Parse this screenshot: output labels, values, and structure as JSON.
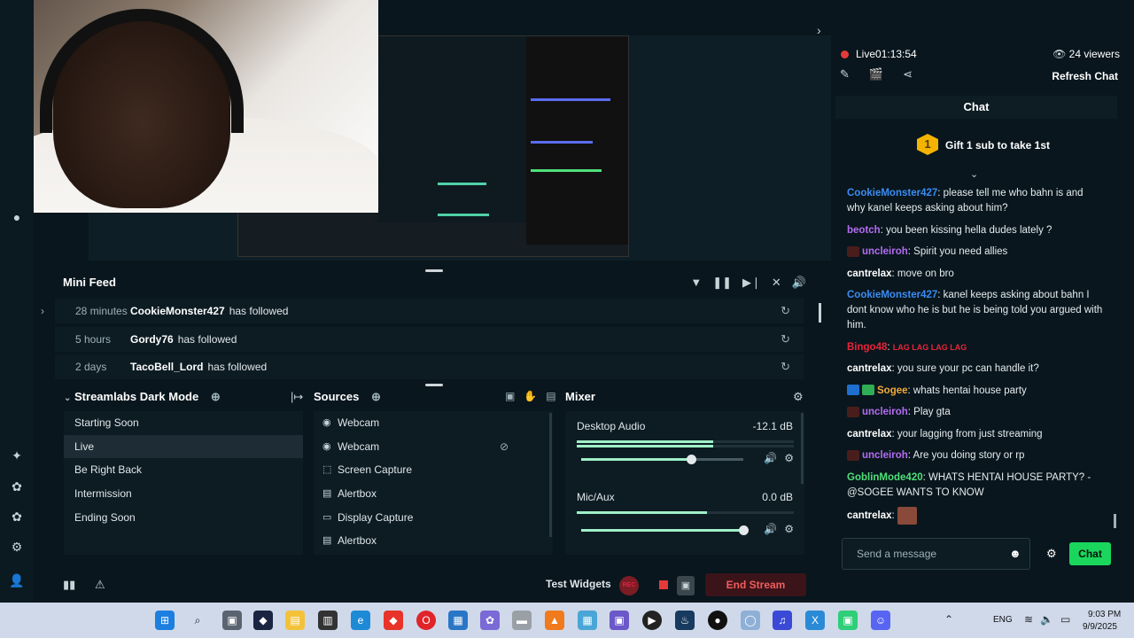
{
  "window": {
    "minimize": "—",
    "maximize": "☐",
    "close": "✕"
  },
  "mini_feed": {
    "title": "Mini Feed",
    "events": [
      {
        "time": "28 minutes",
        "user": "CookieMonster427",
        "action": "has followed"
      },
      {
        "time": "5 hours",
        "user": "Gordy76",
        "action": "has followed"
      },
      {
        "time": "2 days",
        "user": "TacoBell_Lord",
        "action": "has followed"
      }
    ]
  },
  "scenes": {
    "title": "Streamlabs Dark Mode",
    "items": [
      "Starting Soon",
      "Live",
      "Be Right Back",
      "Intermission",
      "Ending Soon"
    ],
    "active": "Live"
  },
  "sources": {
    "title": "Sources",
    "items": [
      {
        "name": "Webcam",
        "icon": "webcam-icon"
      },
      {
        "name": "Webcam",
        "icon": "webcam-icon"
      },
      {
        "name": "Screen Capture",
        "icon": "screen-capture-icon"
      },
      {
        "name": "Alertbox",
        "icon": "alertbox-icon"
      },
      {
        "name": "Display Capture",
        "icon": "display-icon"
      },
      {
        "name": "Alertbox",
        "icon": "alertbox-icon"
      }
    ]
  },
  "mixer": {
    "title": "Mixer",
    "channels": [
      {
        "name": "Desktop Audio",
        "db": "-12.1 dB",
        "meter": 0.63,
        "volume": 0.68
      },
      {
        "name": "Mic/Aux",
        "db": "0.0 dB",
        "meter": 0.6,
        "volume": 1.0
      }
    ]
  },
  "footer": {
    "test_widgets": "Test Widgets",
    "rec": "REC",
    "end_stream": "End Stream"
  },
  "stream": {
    "live_label": "Live",
    "live_time": "01:13:54",
    "viewers": "24 viewers",
    "refresh_chat": "Refresh Chat"
  },
  "chat": {
    "title": "Chat",
    "gift_badge": "1",
    "gift_text": "Gift 1 sub to take 1st",
    "messages": [
      {
        "user": "CookieMonster427",
        "color": "#3b8cf2",
        "text": "please tell me who bahn is and why kanel keeps asking about him?"
      },
      {
        "user": "beotch",
        "color": "#b46cf2",
        "text": "you been kissing hella dudes lately ?"
      },
      {
        "user": "uncleiroh",
        "color": "#b46cf2",
        "text": "Spirit you need allies"
      },
      {
        "user": "cantrelax",
        "color": "#ffffff",
        "text": "move on bro"
      },
      {
        "user": "CookieMonster427",
        "color": "#3b8cf2",
        "text": "kanel keeps asking about bahn I dont know who he is but he is being told you argued with him."
      },
      {
        "user": "Bingo48",
        "color": "#e8253a",
        "text": "LAG LAG LAG LAG"
      },
      {
        "user": "cantrelax",
        "color": "#ffffff",
        "text": "you sure your pc can handle it?"
      },
      {
        "user": "Sogee",
        "color": "#f2a93b",
        "text": "whats hentai house party"
      },
      {
        "user": "uncleiroh",
        "color": "#b46cf2",
        "text": "Play gta"
      },
      {
        "user": "cantrelax",
        "color": "#ffffff",
        "text": "your lagging from just streaming"
      },
      {
        "user": "uncleiroh",
        "color": "#b46cf2",
        "text": "Are you doing story or rp"
      },
      {
        "user": "GoblinMode420",
        "color": "#4fe07a",
        "text": "WHATS HENTAI HOUSE PARTY? - @SOGEE WANTS TO KNOW"
      },
      {
        "user": "cantrelax",
        "color": "#ffffff",
        "text": ""
      }
    ],
    "input_placeholder": "Send a message",
    "send_label": "Chat"
  },
  "taskbar": {
    "language": "ENG",
    "time": "9:03 PM",
    "date": "9/9/2025"
  }
}
